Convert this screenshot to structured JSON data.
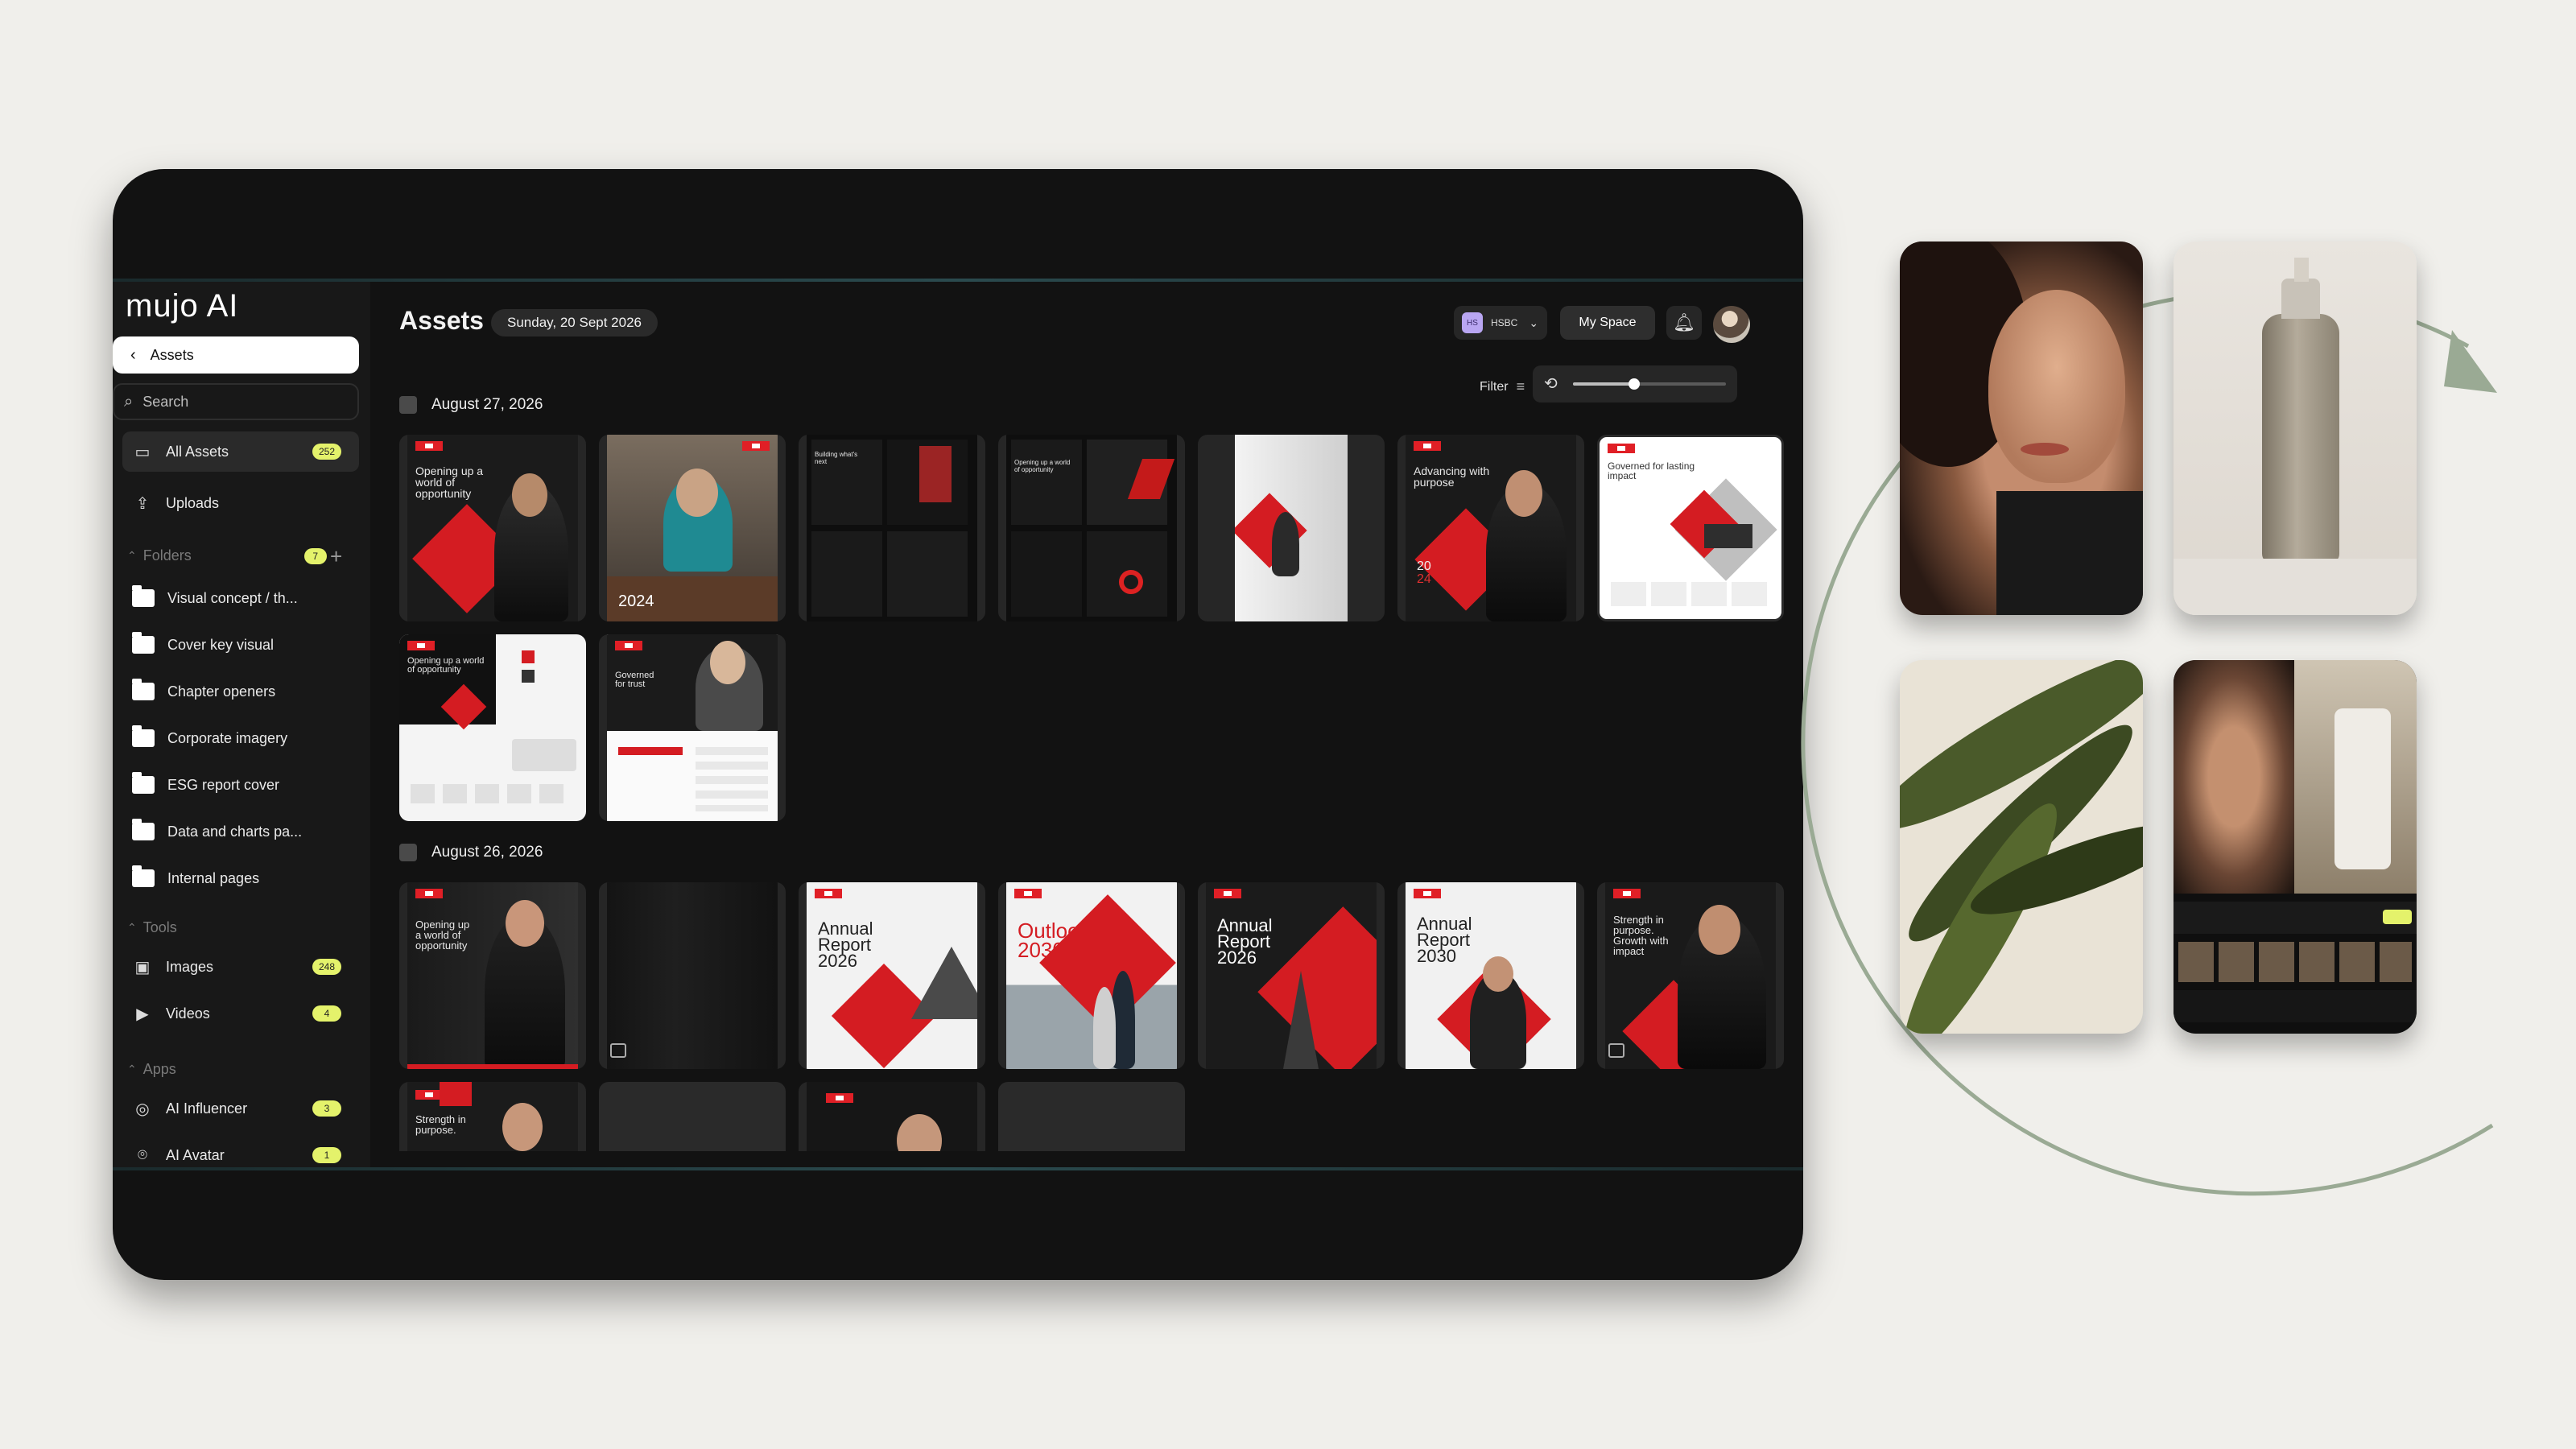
{
  "app": {
    "logo": "mujo AI"
  },
  "sidebar": {
    "back_label": "Assets",
    "search_placeholder": "Search",
    "all_assets": {
      "label": "All Assets",
      "count": "252"
    },
    "uploads": {
      "label": "Uploads"
    },
    "folders_section": {
      "label": "Folders",
      "count": "7"
    },
    "folders": [
      "Visual concept / th...",
      "Cover key visual",
      "Chapter openers",
      "Corporate imagery",
      "ESG report cover",
      "Data and charts pa...",
      "Internal pages"
    ],
    "tools_section": {
      "label": "Tools"
    },
    "tools": [
      {
        "label": "Images",
        "count": "248"
      },
      {
        "label": "Videos",
        "count": "4"
      }
    ],
    "apps_section": {
      "label": "Apps"
    },
    "apps": [
      {
        "label": "AI Influencer",
        "count": "3"
      },
      {
        "label": "AI Avatar",
        "count": "1"
      }
    ]
  },
  "header": {
    "title": "Assets",
    "date": "Sunday, 20 Sept 2026",
    "org": "HSBC",
    "org_initials": "HS",
    "space_button": "My Space",
    "filter_label": "Filter",
    "zoom_level": 0.4
  },
  "groups": [
    {
      "date": "August 27, 2026",
      "items": [
        {
          "theme": "dark",
          "text": "Opening up a world of opportunity"
        },
        {
          "theme": "photo",
          "text": "2024"
        },
        {
          "theme": "dark-grid",
          "text": "Building what's next"
        },
        {
          "theme": "dark-grid",
          "text": "Opening up a world of opportunity"
        },
        {
          "theme": "light",
          "text": ""
        },
        {
          "theme": "dark",
          "text": "Advancing with purpose"
        },
        {
          "theme": "white",
          "text": "Governed for lasting impact"
        },
        {
          "theme": "white-dark",
          "text": "Opening up a world of opportunity"
        },
        {
          "theme": "white-dark",
          "text": "Governed for trust"
        }
      ]
    },
    {
      "date": "August 26, 2026",
      "items": [
        {
          "theme": "dark",
          "text": "Opening up a world of opportunity"
        },
        {
          "theme": "video",
          "text": ""
        },
        {
          "theme": "annual-light",
          "text": "Annual Report 2026"
        },
        {
          "theme": "outlook",
          "text": "Outlook 2030"
        },
        {
          "theme": "annual-dark",
          "text": "Annual Report 2026"
        },
        {
          "theme": "annual-light2",
          "text": "Annual Report 2030"
        },
        {
          "theme": "dark",
          "text": "Strength in purpose. Growth with impact"
        },
        {
          "theme": "dark",
          "text": "Strength in purpose."
        },
        {
          "theme": "empty",
          "text": ""
        },
        {
          "theme": "portrait",
          "text": ""
        },
        {
          "theme": "empty",
          "text": ""
        }
      ]
    }
  ],
  "gallery": [
    {
      "subject": "portrait-face"
    },
    {
      "subject": "skincare-bottle"
    },
    {
      "subject": "palm-leaf"
    },
    {
      "subject": "app-screen"
    }
  ],
  "colors": {
    "brand_red": "#d41c22",
    "badge_yellow": "#e4f26b",
    "ring_green": "#9aaa94",
    "screen_bg": "#121212"
  }
}
